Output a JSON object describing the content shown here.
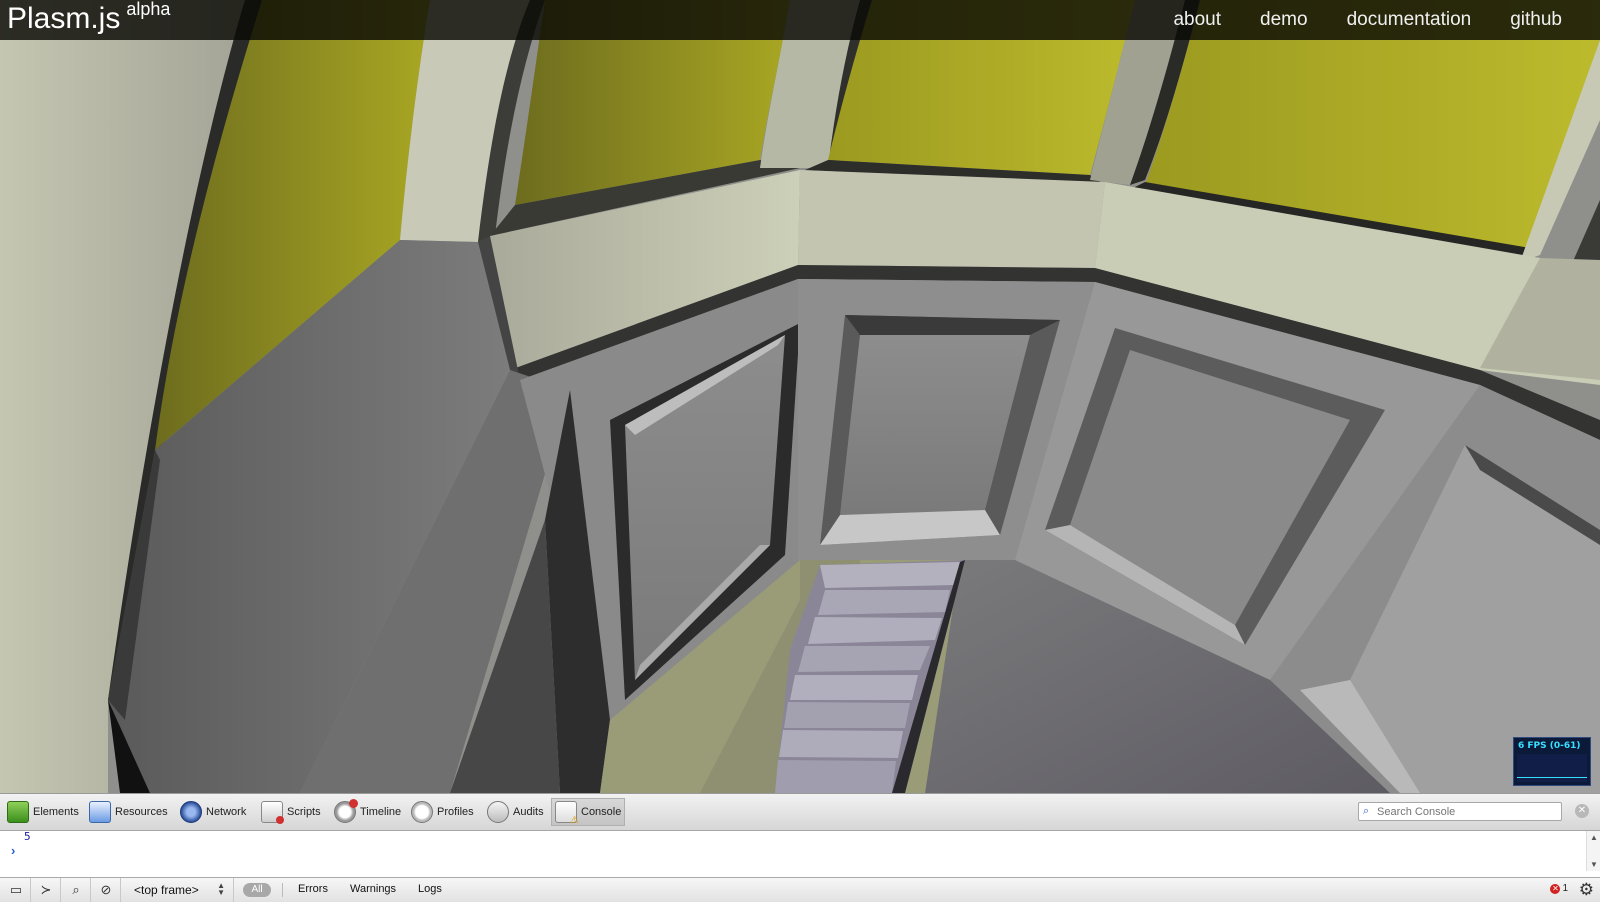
{
  "site": {
    "brand": "Plasm.js",
    "brand_tag": "alpha",
    "nav": [
      "about",
      "demo",
      "documentation",
      "github"
    ]
  },
  "fps_meter": {
    "label": "6 FPS (0-61)"
  },
  "devtools": {
    "tabs": [
      {
        "label": "Elements",
        "icon": "elements-icon"
      },
      {
        "label": "Resources",
        "icon": "resources-icon"
      },
      {
        "label": "Network",
        "icon": "network-icon"
      },
      {
        "label": "Scripts",
        "icon": "scripts-icon"
      },
      {
        "label": "Timeline",
        "icon": "timeline-icon"
      },
      {
        "label": "Profiles",
        "icon": "profiles-icon"
      },
      {
        "label": "Audits",
        "icon": "audits-icon"
      },
      {
        "label": "Console",
        "icon": "console-icon"
      }
    ],
    "selected_tab": "Console",
    "search_placeholder": "Search Console",
    "console": {
      "output": "5",
      "prompt": "›"
    },
    "status": {
      "frame": "<top frame>",
      "filter_all": "All",
      "filters": [
        "Errors",
        "Warnings",
        "Logs"
      ],
      "error_count": "1"
    }
  },
  "colors": {
    "topbar": "#151508",
    "window_yellow": "#a7a620",
    "wall_light": "#c9cbb4",
    "wall_grey": "#8e8e8e"
  }
}
